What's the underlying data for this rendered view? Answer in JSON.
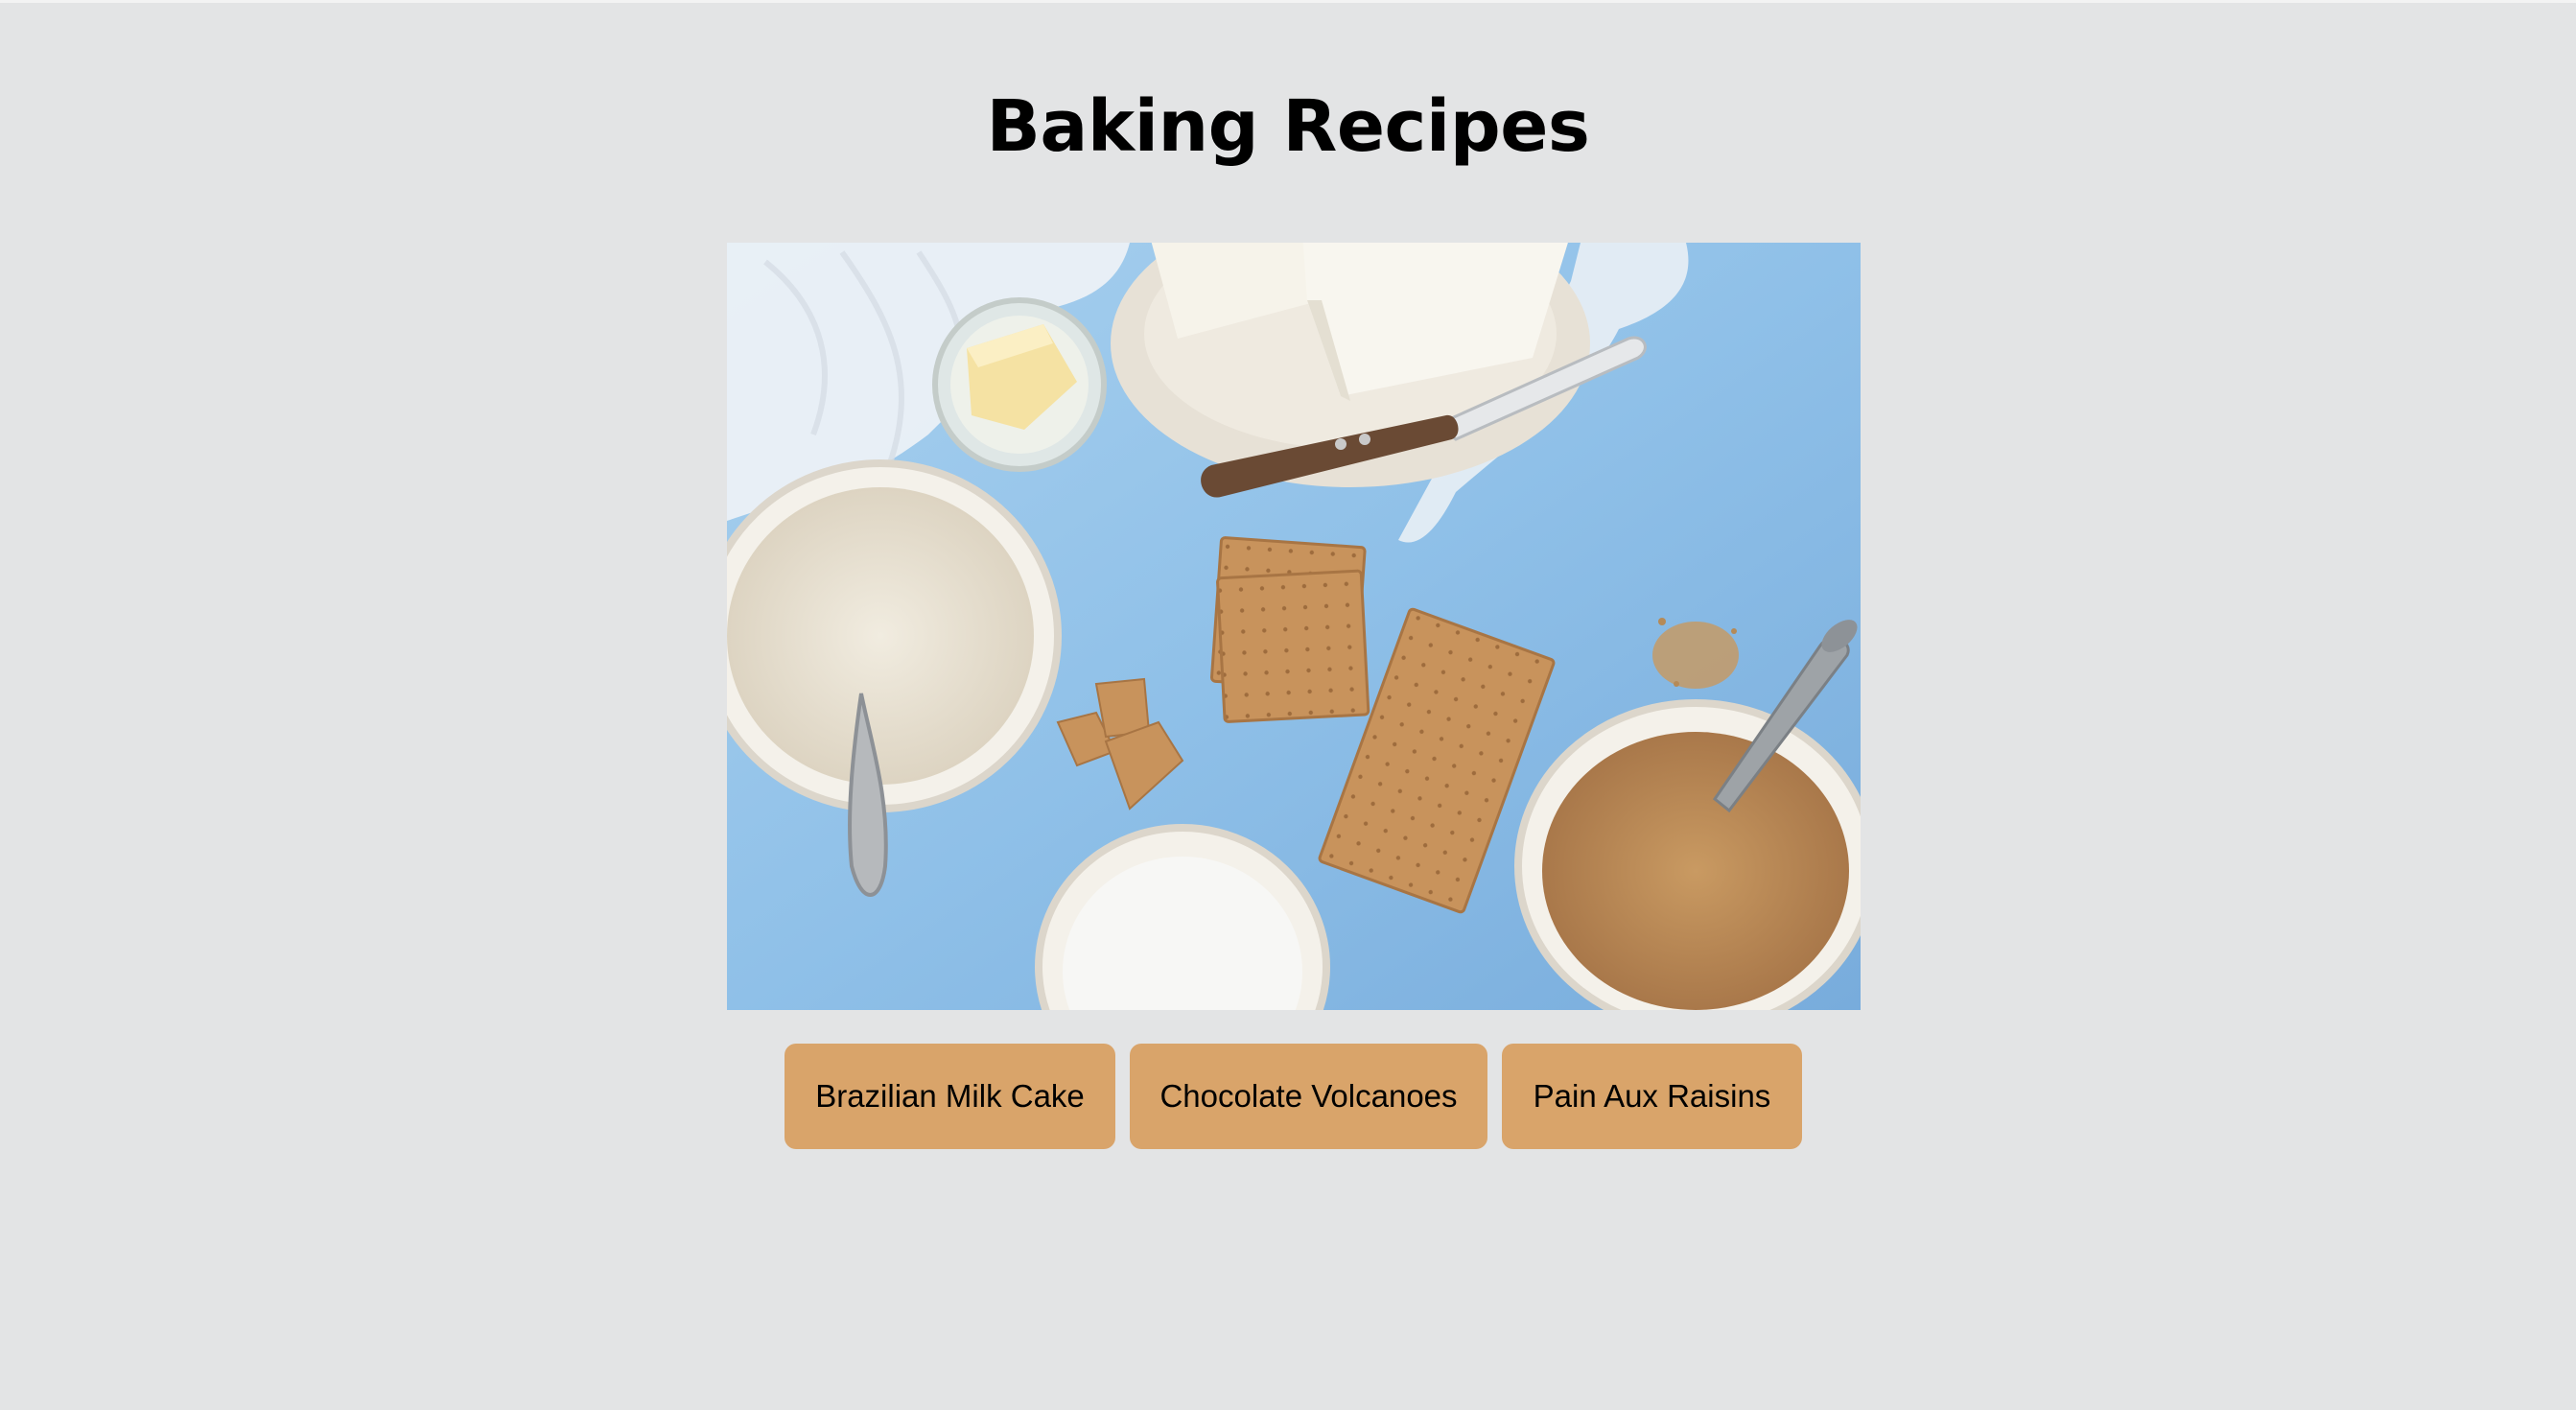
{
  "page": {
    "title": "Baking Recipes",
    "background_color": "#e3e4e5"
  },
  "hero_image": {
    "subject": "flat-lay baking ingredients on blue surface",
    "icon": "image-icon"
  },
  "recipes": [
    {
      "label": "Brazilian Milk Cake"
    },
    {
      "label": "Chocolate Volcanoes"
    },
    {
      "label": "Pain Aux Raisins"
    }
  ],
  "colors": {
    "button": "#d9a46a",
    "button_text": "#000000",
    "title_text": "#000000",
    "image_backdrop": "#9fcbec"
  }
}
